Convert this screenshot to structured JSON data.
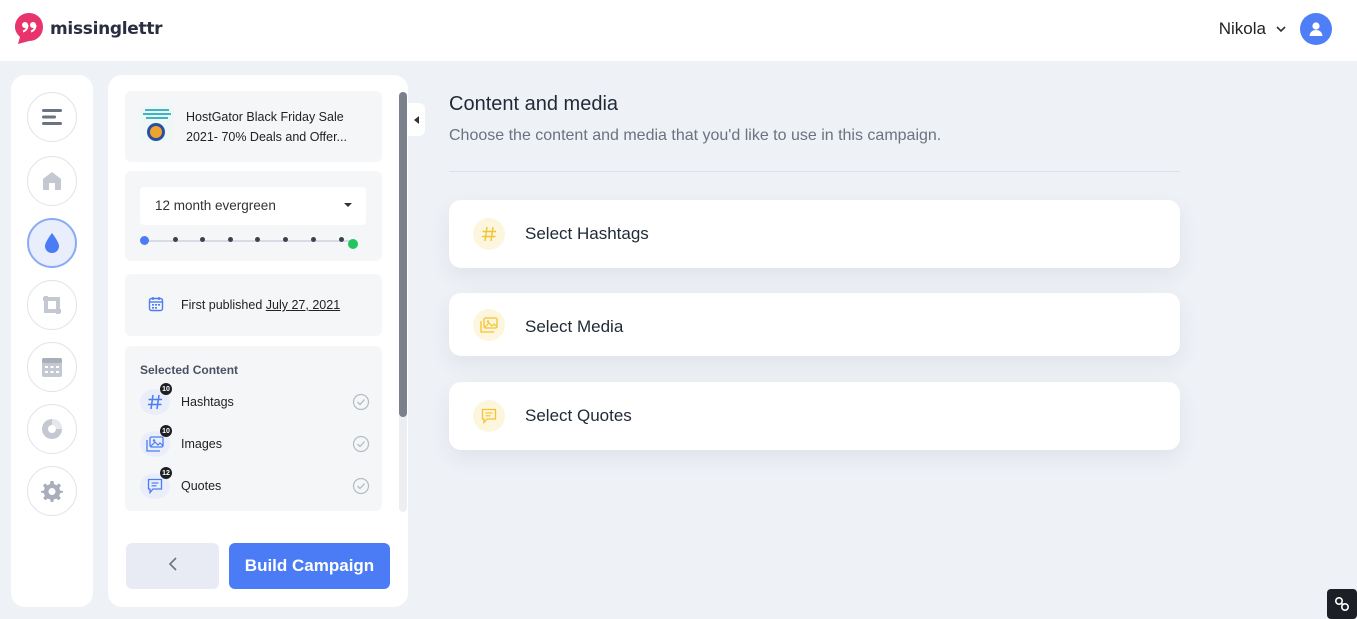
{
  "app": {
    "logo_text": "missinglettr"
  },
  "user": {
    "name": "Nikola"
  },
  "rail": {
    "items": [
      {
        "icon": "menu-icon"
      },
      {
        "icon": "home-icon"
      },
      {
        "icon": "drop-icon",
        "active": true
      },
      {
        "icon": "repeat-icon"
      },
      {
        "icon": "calendar-icon"
      },
      {
        "icon": "chart-pie-icon"
      },
      {
        "icon": "gear-icon"
      }
    ]
  },
  "panel": {
    "post": {
      "title": "HostGator Black Friday Sale 2021- 70% Deals and Offer..."
    },
    "schedule": {
      "selected": "12 month evergreen",
      "timeline_points": 9
    },
    "published": {
      "label": "First published",
      "date": "July 27, 2021"
    },
    "selected_content": {
      "title": "Selected Content",
      "items": [
        {
          "label": "Hashtags",
          "count": "10",
          "icon": "hashtag-icon"
        },
        {
          "label": "Images",
          "count": "10",
          "icon": "images-icon"
        },
        {
          "label": "Quotes",
          "count": "12",
          "icon": "quote-icon"
        }
      ]
    },
    "build_label": "Build Campaign"
  },
  "main": {
    "title": "Content and media",
    "subtitle": "Choose the content and media that you'd like to use in this campaign.",
    "options": [
      {
        "label": "Select Hashtags",
        "icon": "hashtag-icon"
      },
      {
        "label": "Select Media",
        "icon": "images-icon"
      },
      {
        "label": "Select Quotes",
        "icon": "quote-icon"
      }
    ]
  },
  "colors": {
    "accent": "#4b7bf5",
    "option_icon_bg": "#fdf6de",
    "option_icon": "#f4c430",
    "success": "#22c55e"
  }
}
